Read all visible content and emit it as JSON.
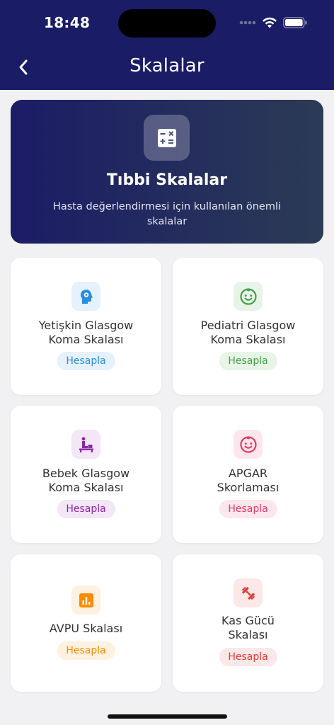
{
  "status_bar": {
    "time": "18:48"
  },
  "header": {
    "title": "Skalalar",
    "back_icon": "chevron-left-icon"
  },
  "hero": {
    "icon": "calculator-icon",
    "title": "Tıbbi Skalalar",
    "subtitle": "Hasta değerlendirmesi için kullanılan önemli skalalar"
  },
  "colors": {
    "header_bg": "#1b1c66",
    "hero_gradient": [
      "#1b1c66",
      "#2c3b55"
    ],
    "blue": "#2b8de0",
    "green": "#43a047",
    "purple": "#8e24aa",
    "pink": "#e23b6a",
    "orange": "#fb8c00",
    "red": "#e53935"
  },
  "cards": [
    {
      "name_line1": "Yetişkin Glasgow",
      "name_line2": "Koma Skalası",
      "button": "Hesapla",
      "icon": "brain-head-icon"
    },
    {
      "name_line1": "Pediatri Glasgow",
      "name_line2": "Koma Skalası",
      "button": "Hesapla",
      "icon": "child-face-icon"
    },
    {
      "name_line1": "Bebek Glasgow",
      "name_line2": "Koma Skalası",
      "button": "Hesapla",
      "icon": "baby-changing-icon"
    },
    {
      "name_line1": "APGAR",
      "name_line2": "Skorlaması",
      "button": "Hesapla",
      "icon": "baby-face-icon"
    },
    {
      "name_line1": "AVPU Skalası",
      "name_line2": "",
      "button": "Hesapla",
      "icon": "bar-chart-icon"
    },
    {
      "name_line1": "Kas Gücü",
      "name_line2": "Skalası",
      "button": "Hesapla",
      "icon": "dumbbell-icon"
    }
  ]
}
